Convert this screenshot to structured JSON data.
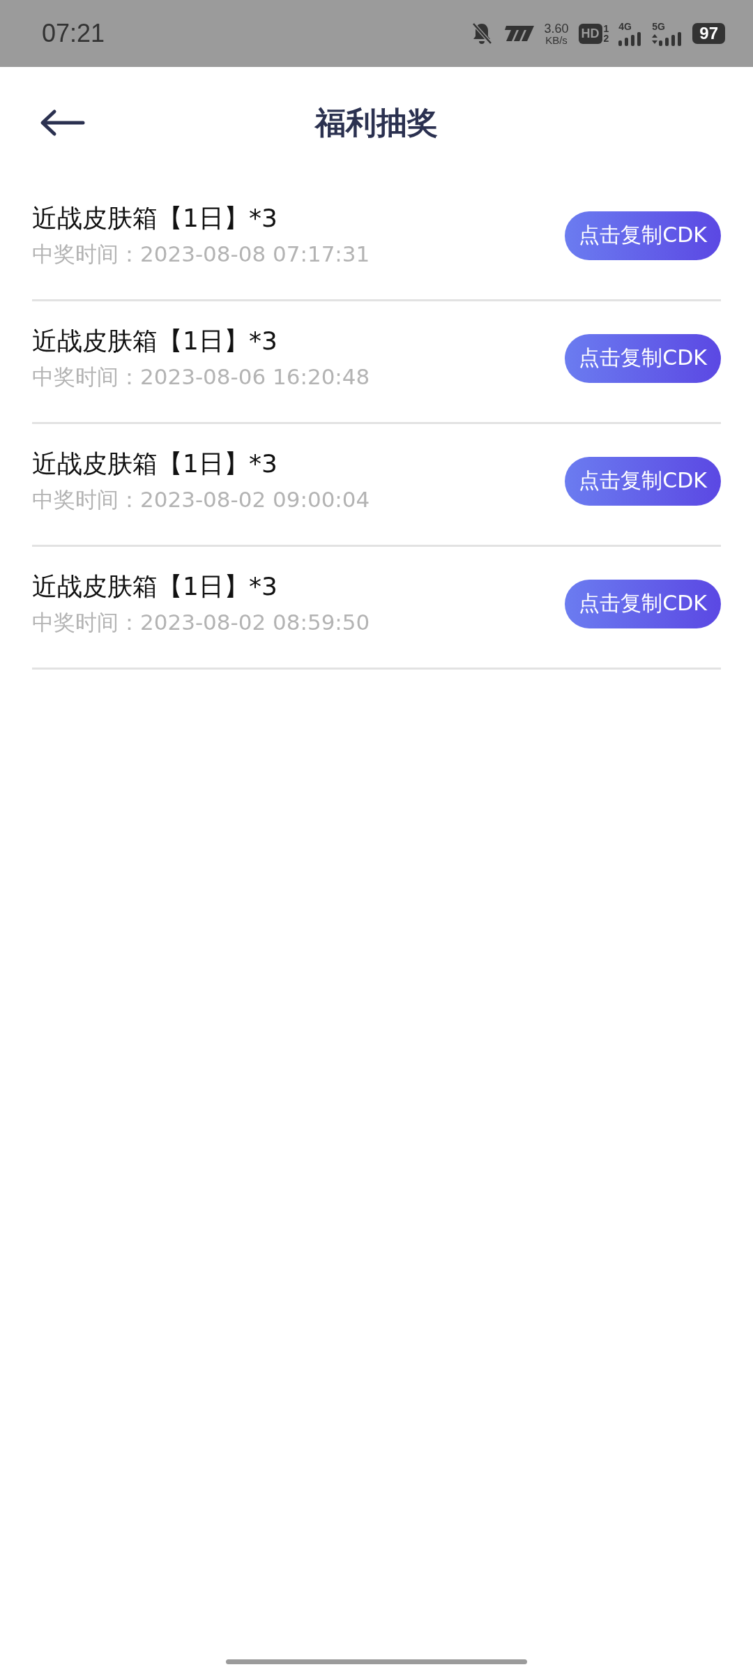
{
  "status_bar": {
    "time": "07:21",
    "speed": "3.60",
    "speed_unit": "KB/s",
    "hd": "HD",
    "sim_1": "1",
    "sim_2": "2",
    "network_1": "4G",
    "network_2": "5G",
    "battery": "97"
  },
  "header": {
    "title": "福利抽奖"
  },
  "prizes": [
    {
      "name": "近战皮肤箱【1日】*3",
      "time": "中奖时间：2023-08-08 07:17:31",
      "button": "点击复制CDK"
    },
    {
      "name": "近战皮肤箱【1日】*3",
      "time": "中奖时间：2023-08-06 16:20:48",
      "button": "点击复制CDK"
    },
    {
      "name": "近战皮肤箱【1日】*3",
      "time": "中奖时间：2023-08-02 09:00:04",
      "button": "点击复制CDK"
    },
    {
      "name": "近战皮肤箱【1日】*3",
      "time": "中奖时间：2023-08-02 08:59:50",
      "button": "点击复制CDK"
    }
  ]
}
